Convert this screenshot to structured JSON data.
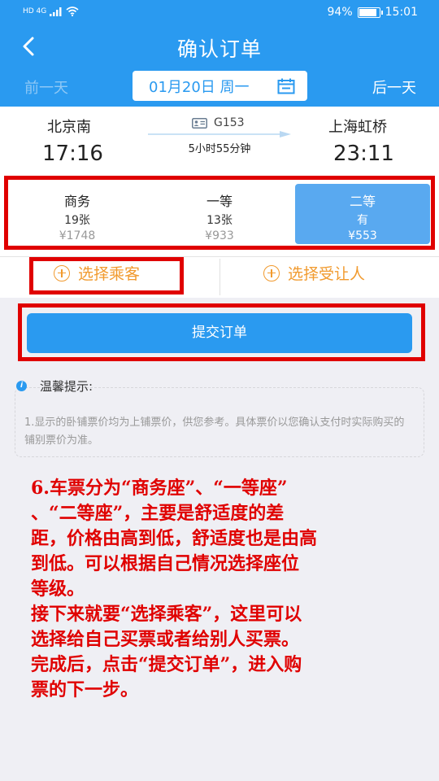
{
  "status_bar": {
    "network": "HD 4G",
    "battery": "94%",
    "time": "15:01"
  },
  "header": {
    "title": "确认订单",
    "prev_day": "前一天",
    "next_day": "后一天",
    "date": "01月20日 周一"
  },
  "train": {
    "from_station": "北京南",
    "from_time": "17:16",
    "to_station": "上海虹桥",
    "to_time": "23:11",
    "number": "G153",
    "duration": "5小时55分钟"
  },
  "seats": [
    {
      "name": "商务",
      "count": "19张",
      "price": "¥1748",
      "selected": false
    },
    {
      "name": "一等",
      "count": "13张",
      "price": "¥933",
      "selected": false
    },
    {
      "name": "二等",
      "count": "有",
      "price": "¥553",
      "selected": true
    }
  ],
  "passenger": {
    "select_passenger": "选择乘客",
    "select_beneficiary": "选择受让人"
  },
  "submit_label": "提交订单",
  "tips": {
    "title": "温馨提示:",
    "text": "1.显示的卧铺票价均为上铺票价，供您参考。具体票价以您确认支付时实际购买的铺别票价为准。"
  },
  "annotation": [
    "6.车票分为“商务座”、“一等座”",
    "、“二等座”，主要是舒适度的差",
    "距，价格由高到低，舒适度也是由高",
    "到低。可以根据自己情况选择座位",
    "等级。",
    "接下来就要“选择乘客”，这里可以",
    "选择给自己买票或者给别人买票。",
    "完成后，点击“提交订单”，进入购",
    "票的下一步。"
  ],
  "colors": {
    "primary": "#2a9af0",
    "seat_selected": "#59a9f0",
    "accent_orange": "#f19a2e",
    "annotation_red": "#e00000"
  }
}
